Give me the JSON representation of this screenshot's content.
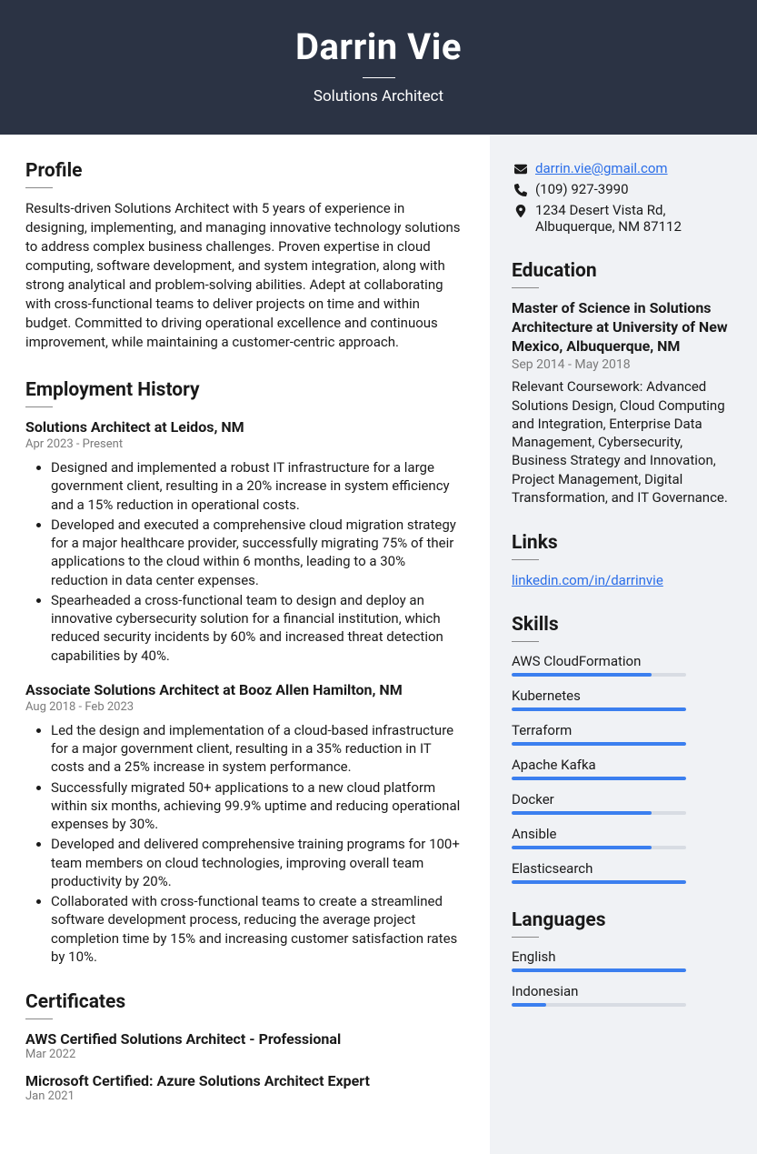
{
  "header": {
    "name": "Darrin Vie",
    "title": "Solutions Architect"
  },
  "profile": {
    "heading": "Profile",
    "text": "Results-driven Solutions Architect with 5 years of experience in designing, implementing, and managing innovative technology solutions to address complex business challenges. Proven expertise in cloud computing, software development, and system integration, along with strong analytical and problem-solving abilities. Adept at collaborating with cross-functional teams to deliver projects on time and within budget. Committed to driving operational excellence and continuous improvement, while maintaining a customer-centric approach."
  },
  "employment": {
    "heading": "Employment History",
    "jobs": [
      {
        "title": "Solutions Architect at Leidos, NM",
        "date": "Apr 2023 - Present",
        "bullets": [
          "Designed and implemented a robust IT infrastructure for a large government client, resulting in a 20% increase in system efficiency and a 15% reduction in operational costs.",
          "Developed and executed a comprehensive cloud migration strategy for a major healthcare provider, successfully migrating 75% of their applications to the cloud within 6 months, leading to a 30% reduction in data center expenses.",
          "Spearheaded a cross-functional team to design and deploy an innovative cybersecurity solution for a financial institution, which reduced security incidents by 60% and increased threat detection capabilities by 40%."
        ]
      },
      {
        "title": "Associate Solutions Architect at Booz Allen Hamilton, NM",
        "date": "Aug 2018 - Feb 2023",
        "bullets": [
          "Led the design and implementation of a cloud-based infrastructure for a major government client, resulting in a 35% reduction in IT costs and a 25% increase in system performance.",
          "Successfully migrated 50+ applications to a new cloud platform within six months, achieving 99.9% uptime and reducing operational expenses by 30%.",
          "Developed and delivered comprehensive training programs for 100+ team members on cloud technologies, improving overall team productivity by 20%.",
          "Collaborated with cross-functional teams to create a streamlined software development process, reducing the average project completion time by 15% and increasing customer satisfaction rates by 10%."
        ]
      }
    ]
  },
  "certificates": {
    "heading": "Certificates",
    "items": [
      {
        "title": "AWS Certified Solutions Architect - Professional",
        "date": "Mar 2022"
      },
      {
        "title": "Microsoft Certified: Azure Solutions Architect Expert",
        "date": "Jan 2021"
      }
    ]
  },
  "contact": {
    "email": "darrin.vie@gmail.com",
    "phone": "(109) 927-3990",
    "address": "1234 Desert Vista Rd, Albuquerque, NM 87112"
  },
  "education": {
    "heading": "Education",
    "degree": "Master of Science in Solutions Architecture at University of New Mexico, Albuquerque, NM",
    "date": "Sep 2014 - May 2018",
    "desc": "Relevant Coursework: Advanced Solutions Design, Cloud Computing and Integration, Enterprise Data Management, Cybersecurity, Business Strategy and Innovation, Project Management, Digital Transformation, and IT Governance."
  },
  "links": {
    "heading": "Links",
    "items": [
      {
        "text": "linkedin.com/in/darrinvie"
      }
    ]
  },
  "skills": {
    "heading": "Skills",
    "items": [
      {
        "name": "AWS CloudFormation",
        "level": 80
      },
      {
        "name": "Kubernetes",
        "level": 100
      },
      {
        "name": "Terraform",
        "level": 100
      },
      {
        "name": "Apache Kafka",
        "level": 100
      },
      {
        "name": "Docker",
        "level": 80
      },
      {
        "name": "Ansible",
        "level": 80
      },
      {
        "name": "Elasticsearch",
        "level": 100
      }
    ]
  },
  "languages": {
    "heading": "Languages",
    "items": [
      {
        "name": "English",
        "level": 100
      },
      {
        "name": "Indonesian",
        "level": 20
      }
    ]
  }
}
